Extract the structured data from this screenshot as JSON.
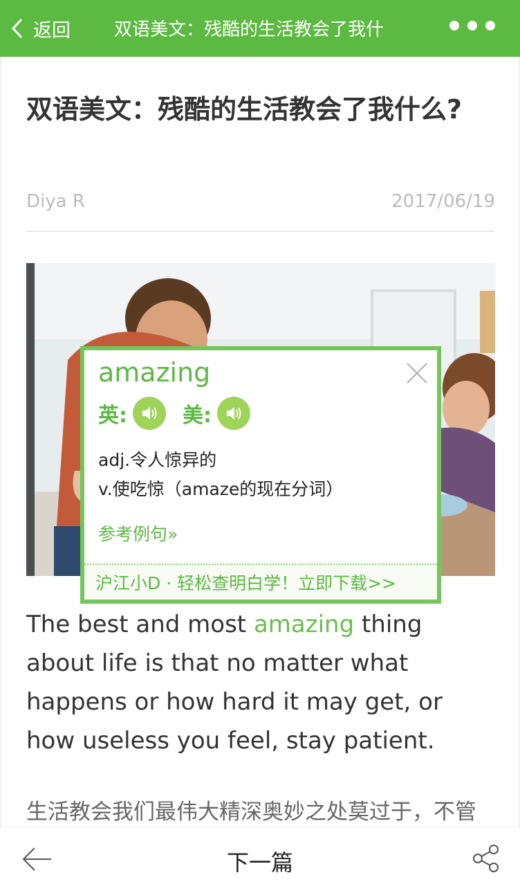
{
  "nav": {
    "back_label": "返回",
    "title": "双语美文：残酷的生活教会了我什",
    "accent": "#5cb942",
    "icons": {
      "back": "chevron-left-icon",
      "more": "more-dots-icon"
    }
  },
  "article": {
    "title": "双语美文：残酷的生活教会了我什么?",
    "author": "Diya R",
    "date": "2017/06/19",
    "para_en": {
      "before": "The best and most ",
      "highlight": "amazing",
      "after": " thing about life is that no matter what happens or how hard it may get, or how useless you feel, stay patient."
    },
    "para_zh": "生活教会我们最伟大精深奥妙之处莫过于，不管"
  },
  "popup": {
    "word": "amazing",
    "uk_label": "英:",
    "us_label": "美:",
    "def1": "adj.令人惊异的",
    "def2": "v.使吃惊（amaze的现在分词）",
    "examples": "参考例句»",
    "footer": "沪江小D · 轻松查明白学！立即下载>>",
    "icons": {
      "close": "close-icon",
      "speaker": "speaker-icon"
    }
  },
  "bottom": {
    "next_label": "下一篇",
    "icons": {
      "prev": "arrow-left-icon",
      "share": "share-icon"
    }
  }
}
